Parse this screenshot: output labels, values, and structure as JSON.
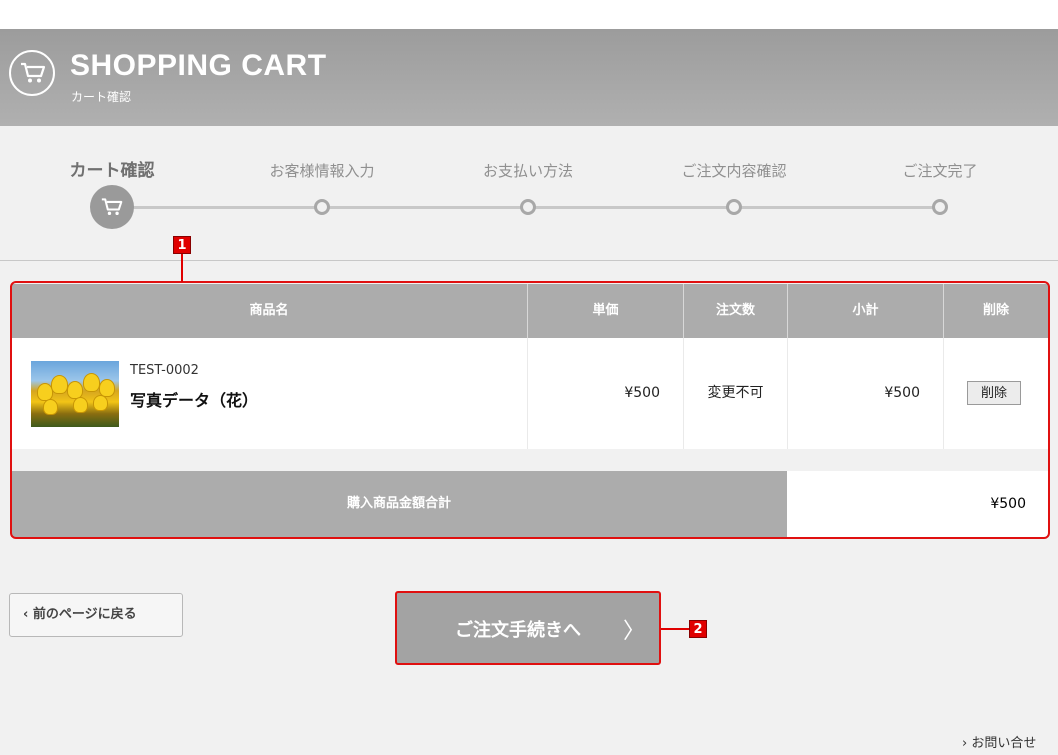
{
  "header": {
    "title": "SHOPPING CART",
    "subtitle": "カート確認",
    "icon": "cart-icon"
  },
  "steps": [
    {
      "label": "カート確認",
      "active": true
    },
    {
      "label": "お客様情報入力",
      "active": false
    },
    {
      "label": "お支払い方法",
      "active": false
    },
    {
      "label": "ご注文内容確認",
      "active": false
    },
    {
      "label": "ご注文完了",
      "active": false
    }
  ],
  "table": {
    "headers": [
      "商品名",
      "単価",
      "注文数",
      "小計",
      "削除"
    ],
    "rows": [
      {
        "sku": "TEST-0002",
        "name": "写真データ（花）",
        "price": "¥500",
        "quantity": "変更不可",
        "subtotal": "¥500",
        "delete_label": "削除",
        "thumbnail": "tulip-photo"
      }
    ],
    "total_label": "購入商品金額合計",
    "total_value": "¥500"
  },
  "annotations": {
    "badge1": "1",
    "badge2": "2",
    "color": "#e01010"
  },
  "buttons": {
    "back": "前のページに戻る",
    "back_icon": "‹",
    "proceed": "ご注文手続きへ",
    "proceed_icon": "〉"
  },
  "footer": {
    "contact": "お問い合せ",
    "contact_icon": "›"
  }
}
